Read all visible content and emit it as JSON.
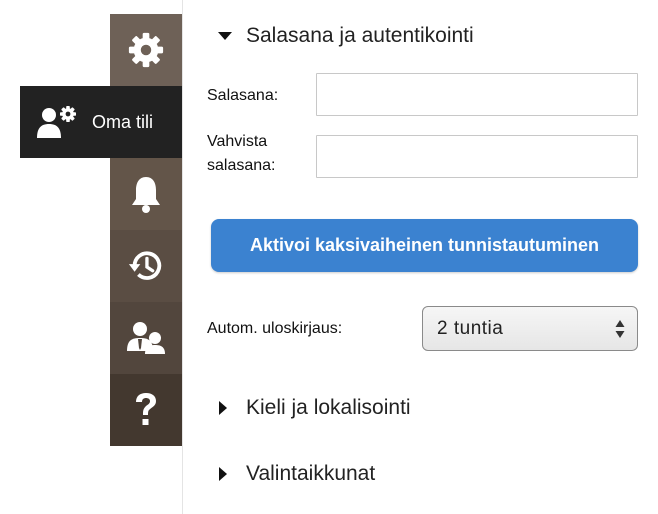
{
  "sidebar": {
    "active_tab": {
      "label": "Oma tili",
      "icon": "user-settings-icon"
    },
    "icons": [
      "gear-icon",
      "user-settings-icon",
      "bell-icon",
      "history-icon",
      "users-icon",
      "question-icon"
    ],
    "colors": {
      "rail": "#6e6157",
      "active": "#222222"
    }
  },
  "password_section": {
    "title": "Salasana ja autentikointi",
    "password_label": "Salasana:",
    "confirm_label_line1": "Vahvista",
    "confirm_label_line2": "salasana:",
    "password_value": "",
    "confirm_value": "",
    "two_factor_button": "Aktivoi kaksivaiheinen tunnistautuminen",
    "logout_label": "Autom. uloskirjaus:",
    "logout_selected": "2 tuntia"
  },
  "language_section": {
    "title": "Kieli ja lokalisointi"
  },
  "dialogs_section": {
    "title": "Valintaikkunat"
  },
  "accent_color": "#3b82d0"
}
